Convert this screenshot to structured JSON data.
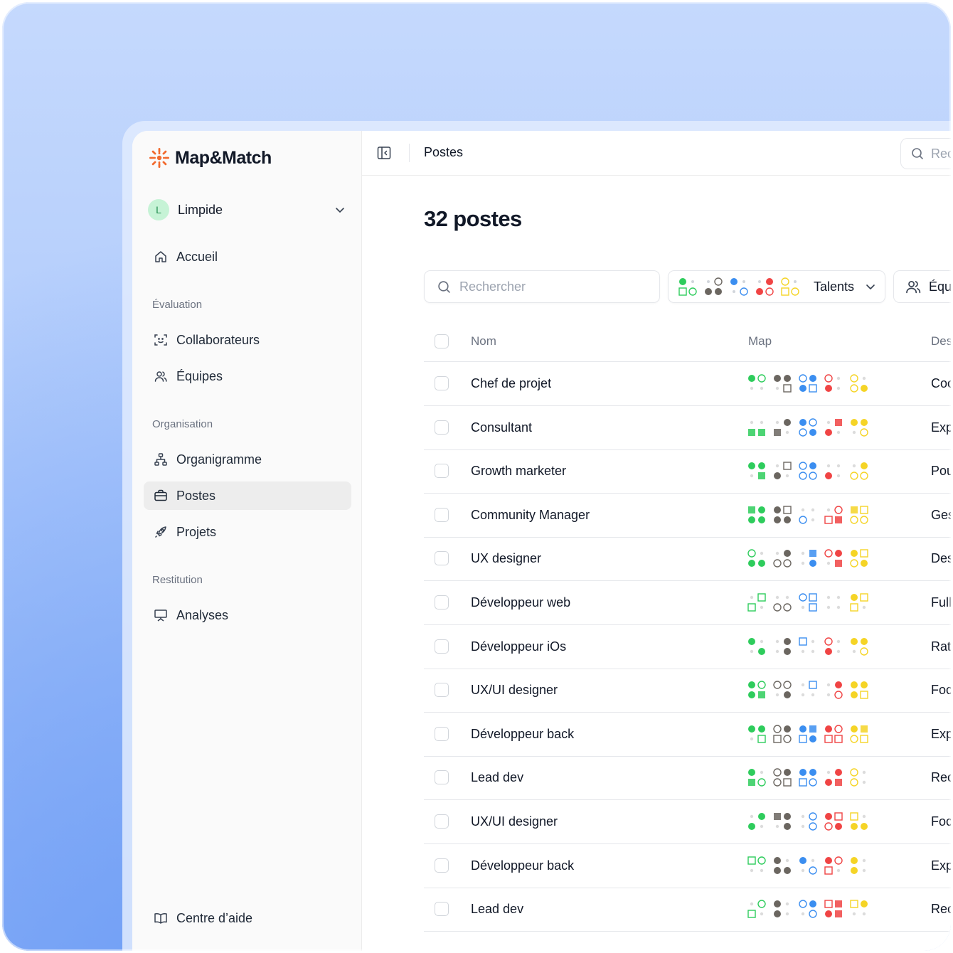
{
  "app": {
    "name": "Map&Match"
  },
  "org": {
    "initial": "L",
    "name": "Limpide"
  },
  "nav": {
    "home": "Accueil",
    "section_eval": "Évaluation",
    "collaborators": "Collaborateurs",
    "teams": "Équipes",
    "section_org": "Organisation",
    "orgchart": "Organigramme",
    "positions": "Postes",
    "projects": "Projets",
    "section_restitution": "Restitution",
    "analyses": "Analyses",
    "help": "Centre d’aide"
  },
  "topbar": {
    "breadcrumb": "Postes",
    "search_placeholder": "Rec"
  },
  "page": {
    "title": "32 postes"
  },
  "filters": {
    "search_placeholder": "Rechercher",
    "talents_label": "Talents",
    "teams_label": "Équ"
  },
  "table": {
    "columns": {
      "name": "Nom",
      "map": "Map",
      "desc": "Des"
    },
    "rows": [
      {
        "name": "Chef de projet",
        "desc": "Coo"
      },
      {
        "name": "Consultant",
        "desc": "Exp"
      },
      {
        "name": "Growth marketer",
        "desc": "Pou"
      },
      {
        "name": "Community Manager",
        "desc": "Ges"
      },
      {
        "name": "UX designer",
        "desc": "Des"
      },
      {
        "name": "Développeur web",
        "desc": "Full"
      },
      {
        "name": "Développeur iOs",
        "desc": "Ratt"
      },
      {
        "name": "UX/UI designer",
        "desc": "Foc"
      },
      {
        "name": "Développeur back",
        "desc": "Exp"
      },
      {
        "name": "Lead dev",
        "desc": "Rec"
      },
      {
        "name": "UX/UI designer",
        "desc": "Foc"
      },
      {
        "name": "Développeur back",
        "desc": "Exp"
      },
      {
        "name": "Lead dev",
        "desc": "Rec"
      }
    ]
  },
  "map_colors": {
    "green": "#2ecc5c",
    "gray": "#6b6660",
    "blue": "#3b8ef0",
    "red": "#f04444",
    "yellow": "#f5d426"
  },
  "brand_color": "#f26a2e",
  "icons": {
    "logo": "sunburst-logo-icon",
    "chevron": "chevron-down-icon",
    "home": "home-icon",
    "collaborators": "face-scan-icon",
    "teams": "users-icon",
    "orgchart": "hierarchy-icon",
    "positions": "briefcase-icon",
    "projects": "rocket-icon",
    "analyses": "presentation-icon",
    "help": "book-icon",
    "sidebar": "sidebar-toggle-icon",
    "search": "search-icon"
  }
}
